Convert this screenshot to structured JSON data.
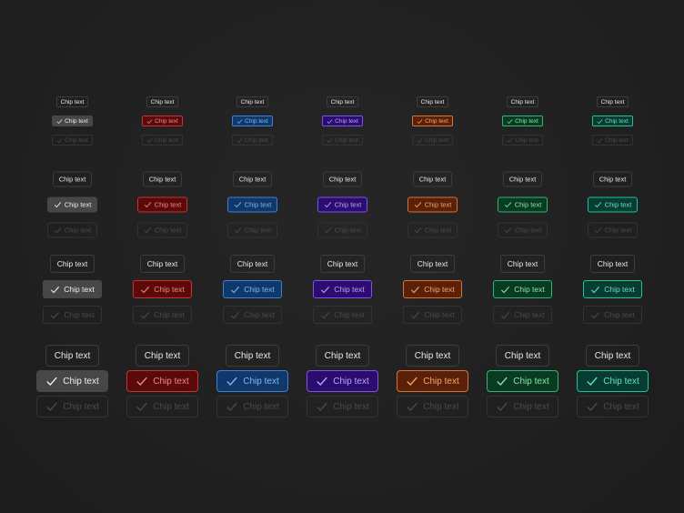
{
  "chip_label": "Chip text",
  "check_icon": "check-icon",
  "sizes": [
    "xs",
    "sm",
    "md",
    "lg"
  ],
  "states": [
    "default",
    "selected",
    "disabled"
  ],
  "variants": [
    {
      "name": "neutral",
      "bg": "#474747",
      "border": "#474747",
      "text": "#f0f0f0"
    },
    {
      "name": "red",
      "bg": "#5c0909",
      "border": "#c23434",
      "text": "#f08a8a"
    },
    {
      "name": "blue",
      "bg": "#10386a",
      "border": "#3f80d8",
      "text": "#80b8f5"
    },
    {
      "name": "purple",
      "bg": "#2c0c6e",
      "border": "#7a55e6",
      "text": "#b8a8ff"
    },
    {
      "name": "orange",
      "bg": "#5a2108",
      "border": "#d47535",
      "text": "#f5a868"
    },
    {
      "name": "green",
      "bg": "#083b22",
      "border": "#33b474",
      "text": "#88e4a8"
    },
    {
      "name": "teal",
      "bg": "#063c31",
      "border": "#22c496",
      "text": "#66e4c4"
    }
  ]
}
